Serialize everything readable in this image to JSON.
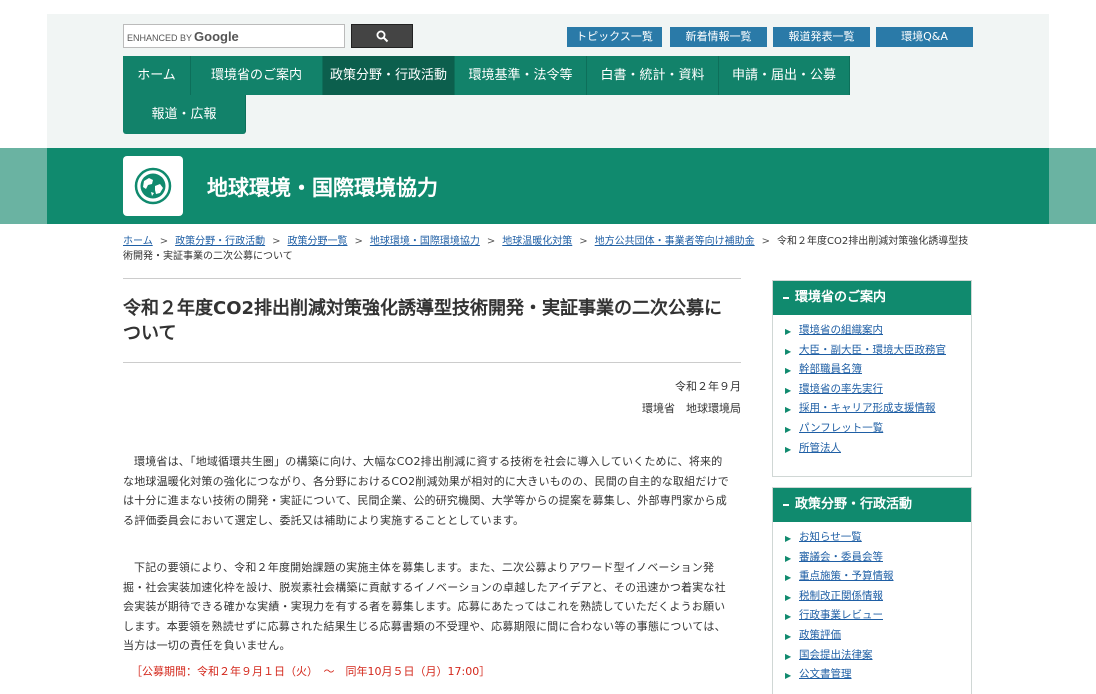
{
  "search": {
    "enhanced_by": "ENHANCED BY",
    "brand": "Google"
  },
  "toplinks": [
    "トピックス一覧",
    "新着情報一覧",
    "報道発表一覧",
    "環境Q&A"
  ],
  "nav": [
    "ホーム",
    "環境省のご案内",
    "政策分野・行政活動",
    "環境基準・法令等",
    "白書・統計・資料",
    "申請・届出・公募",
    "報道・広報"
  ],
  "category": {
    "title": "地球環境・国際環境協力"
  },
  "breadcrumb": {
    "links": [
      "ホーム",
      "政策分野・行政活動",
      "政策分野一覧",
      "地球環境・国際環境協力",
      "地球温暖化対策",
      "地方公共団体・事業者等向け補助金"
    ],
    "current": "令和２年度CO2排出削減対策強化誘導型技術開発・実証事業の二次公募について"
  },
  "article": {
    "title": "令和２年度CO2排出削減対策強化誘導型技術開発・実証事業の二次公募について",
    "date": "令和２年９月",
    "org": "環境省　地球環境局",
    "para1": "環境省は、「地域循環共生圏」の構築に向け、大幅なCO2排出削減に資する技術を社会に導入していくために、将来的な地球温暖化対策の強化につながり、各分野におけるCO2削減効果が相対的に大きいものの、民間の自主的な取組だけでは十分に進まない技術の開発・実証について、民間企業、公的研究機関、大学等からの提案を募集し、外部専門家から成る評価委員会において選定し、委託又は補助により実施することとしています。",
    "para2": "下記の要領により、令和２年度開始課題の実施主体を募集します。また、二次公募よりアワード型イノベーション発掘・社会実装加速化枠を設け、脱炭素社会構築に貢献するイノベーションの卓越したアイデアと、その迅速かつ着実な社会実装が期待できる確かな実績・実現力を有する者を募集します。応募にあたってはこれを熟読していただくようお願いします。本要領を熟読せずに応募された結果生じる応募書類の不受理や、応募期限に間に合わない等の事態については、当方は一切の責任を負いません。",
    "period": "［公募期間：令和２年９月１日（火）　～　同年10月５日（月）17:00］"
  },
  "sidebar": [
    {
      "heading": "環境省のご案内",
      "items": [
        "環境省の組織案内",
        "大臣・副大臣・環境大臣政務官",
        "幹部職員名簿",
        "環境省の率先実行",
        "採用・キャリア形成支援情報",
        "パンフレット一覧",
        "所管法人"
      ]
    },
    {
      "heading": "政策分野・行政活動",
      "items": [
        "お知らせ一覧",
        "審議会・委員会等",
        "重点施策・予算情報",
        "税制改正関係情報",
        "行政事業レビュー",
        "政策評価",
        "国会提出法律案",
        "公文書管理"
      ]
    }
  ],
  "colors": {
    "nav": "#12826a",
    "nav_active": "#0c5f4d",
    "toplink": "#2a7aa8",
    "link": "#1f5fa5",
    "period": "#d4281c"
  }
}
